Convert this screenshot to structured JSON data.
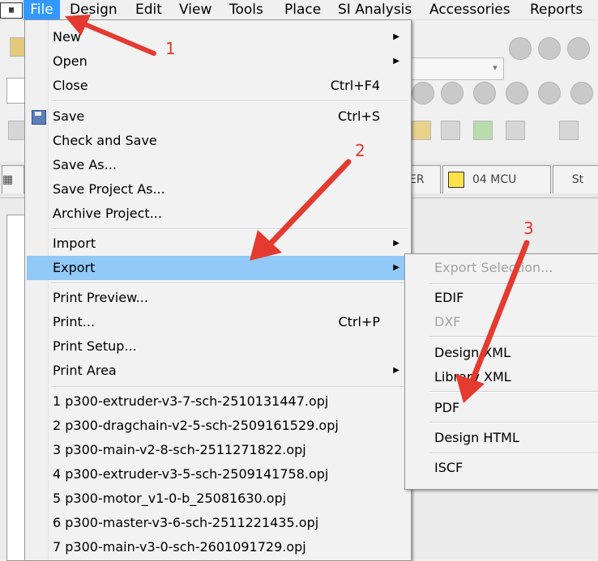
{
  "menubar": {
    "items": [
      "File",
      "Design",
      "Edit",
      "View",
      "Tools",
      "Place",
      "SI Analysis",
      "Accessories",
      "Reports"
    ]
  },
  "tabs": {
    "tab2": "ER",
    "tab3": "04 MCU",
    "tab4": "St"
  },
  "file_menu": {
    "new": "New",
    "open": "Open",
    "close": "Close",
    "close_shortcut": "Ctrl+F4",
    "save": "Save",
    "save_shortcut": "Ctrl+S",
    "check_and_save": "Check and Save",
    "save_as": "Save As...",
    "save_project_as": "Save Project As...",
    "archive_project": "Archive Project...",
    "import": "Import",
    "export": "Export",
    "print_preview": "Print Preview...",
    "print": "Print...",
    "print_shortcut": "Ctrl+P",
    "print_setup": "Print Setup...",
    "print_area": "Print Area",
    "recent": [
      "1 p300-extruder-v3-7-sch-2510131447.opj",
      "2 p300-dragchain-v2-5-sch-2509161529.opj",
      "3 p300-main-v2-8-sch-2511271822.opj",
      "4 p300-extruder-v3-5-sch-2509141758.opj",
      "5 p300-motor_v1-0-b_25081630.opj",
      "6 p300-master-v3-6-sch-2511221435.opj",
      "7 p300-main-v3-0-sch-2601091729.opj"
    ]
  },
  "export_menu": {
    "export_selection": "Export Selection...",
    "edif": "EDIF",
    "dxf": "DXF",
    "design_xml": "Design XML",
    "library_xml": "Library XML",
    "pdf": "PDF",
    "design_html": "Design HTML",
    "iscf": "ISCF"
  },
  "annotations": {
    "step1": "1",
    "step2": "2",
    "step3": "3",
    "arrow_color": "#e53a2f"
  },
  "colors": {
    "menu_highlight": "#91c9f7",
    "menubar_active": "#3399ff"
  }
}
